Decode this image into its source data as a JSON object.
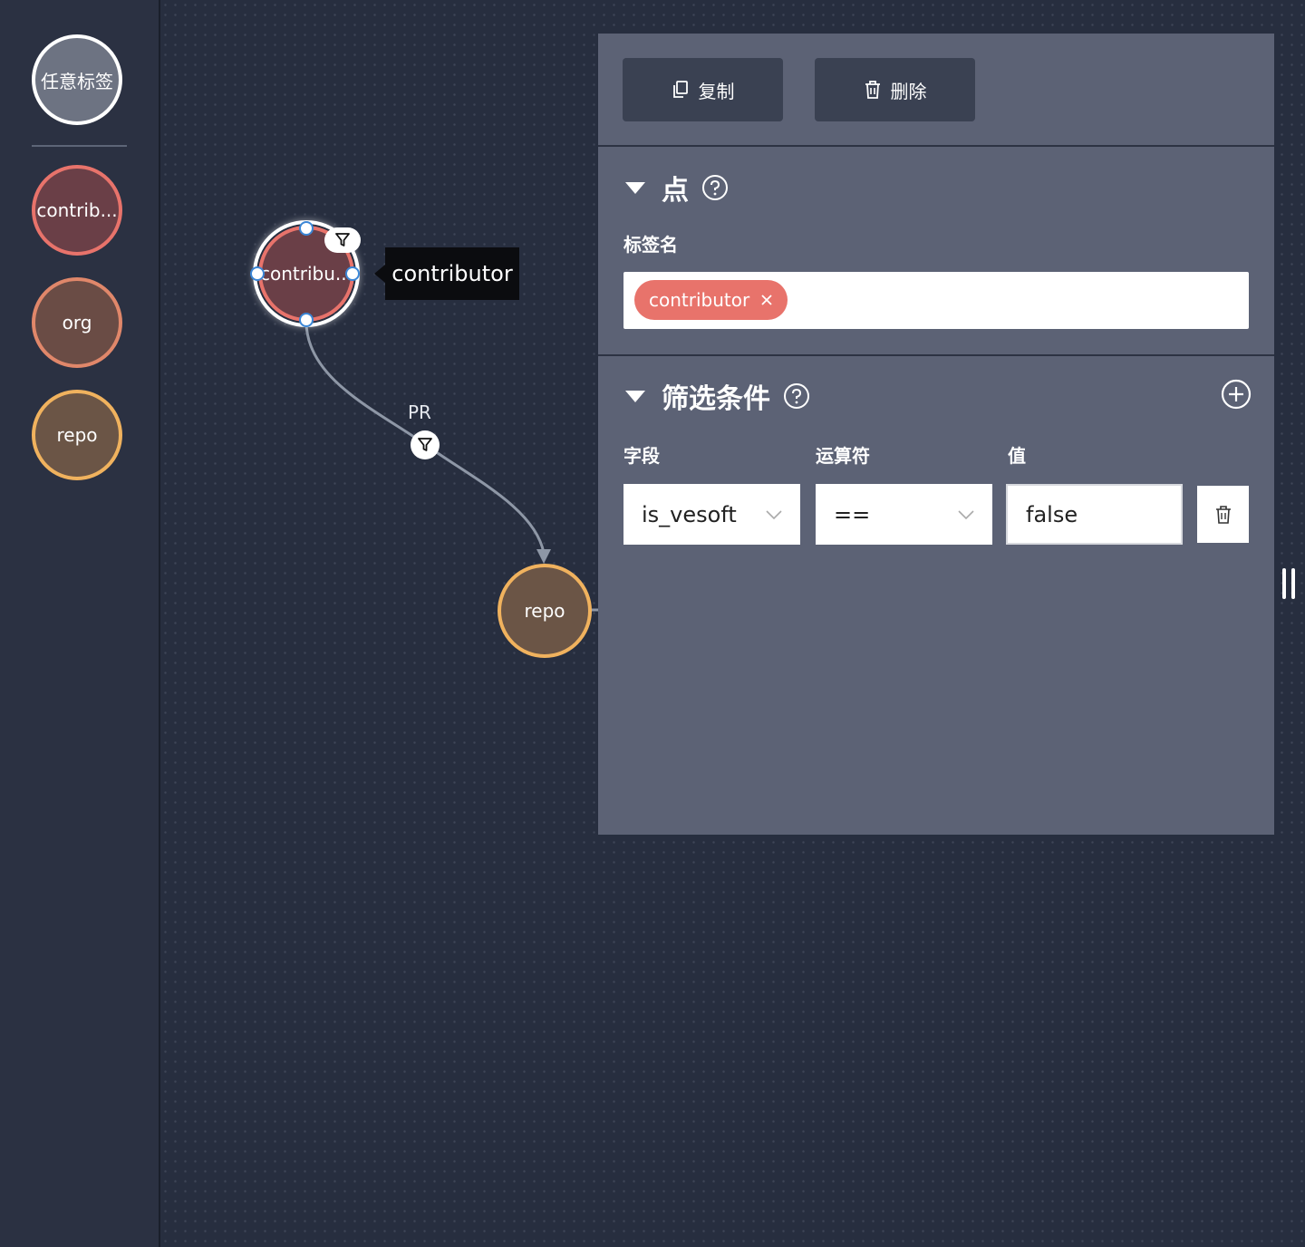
{
  "sidebar": {
    "items": [
      {
        "label": "任意标签",
        "fill": "#6d7382",
        "border": "#ffffff"
      },
      {
        "label": "contrib...",
        "fill": "#6a3f47",
        "border": "#e8736b"
      },
      {
        "label": "org",
        "fill": "#6a4c45",
        "border": "#e0876a"
      },
      {
        "label": "repo",
        "fill": "#6b5546",
        "border": "#f0b25e"
      }
    ]
  },
  "graph": {
    "nodes": [
      {
        "label": "contribu...",
        "fill": "#6a3f47",
        "border": "#e8736b",
        "selected": true
      },
      {
        "label": "repo",
        "fill": "#6b5546",
        "border": "#f0b25e",
        "selected": false
      }
    ],
    "tooltip": "contributor",
    "edge": {
      "label": "PR"
    }
  },
  "panel": {
    "copy_label": "复制",
    "delete_label": "删除",
    "vertex_section": {
      "title": "点",
      "tag_label": "标签名",
      "tags": [
        "contributor"
      ]
    },
    "filter_section": {
      "title": "筛选条件",
      "col_field": "字段",
      "col_operator": "运算符",
      "col_value": "值",
      "row": {
        "field": "is_vesoft",
        "operator": "==",
        "value": "false"
      }
    }
  },
  "icons": [
    "copy-icon",
    "trash-icon",
    "help-icon",
    "add-circle-icon",
    "filter-icon",
    "chevron-down-icon"
  ]
}
